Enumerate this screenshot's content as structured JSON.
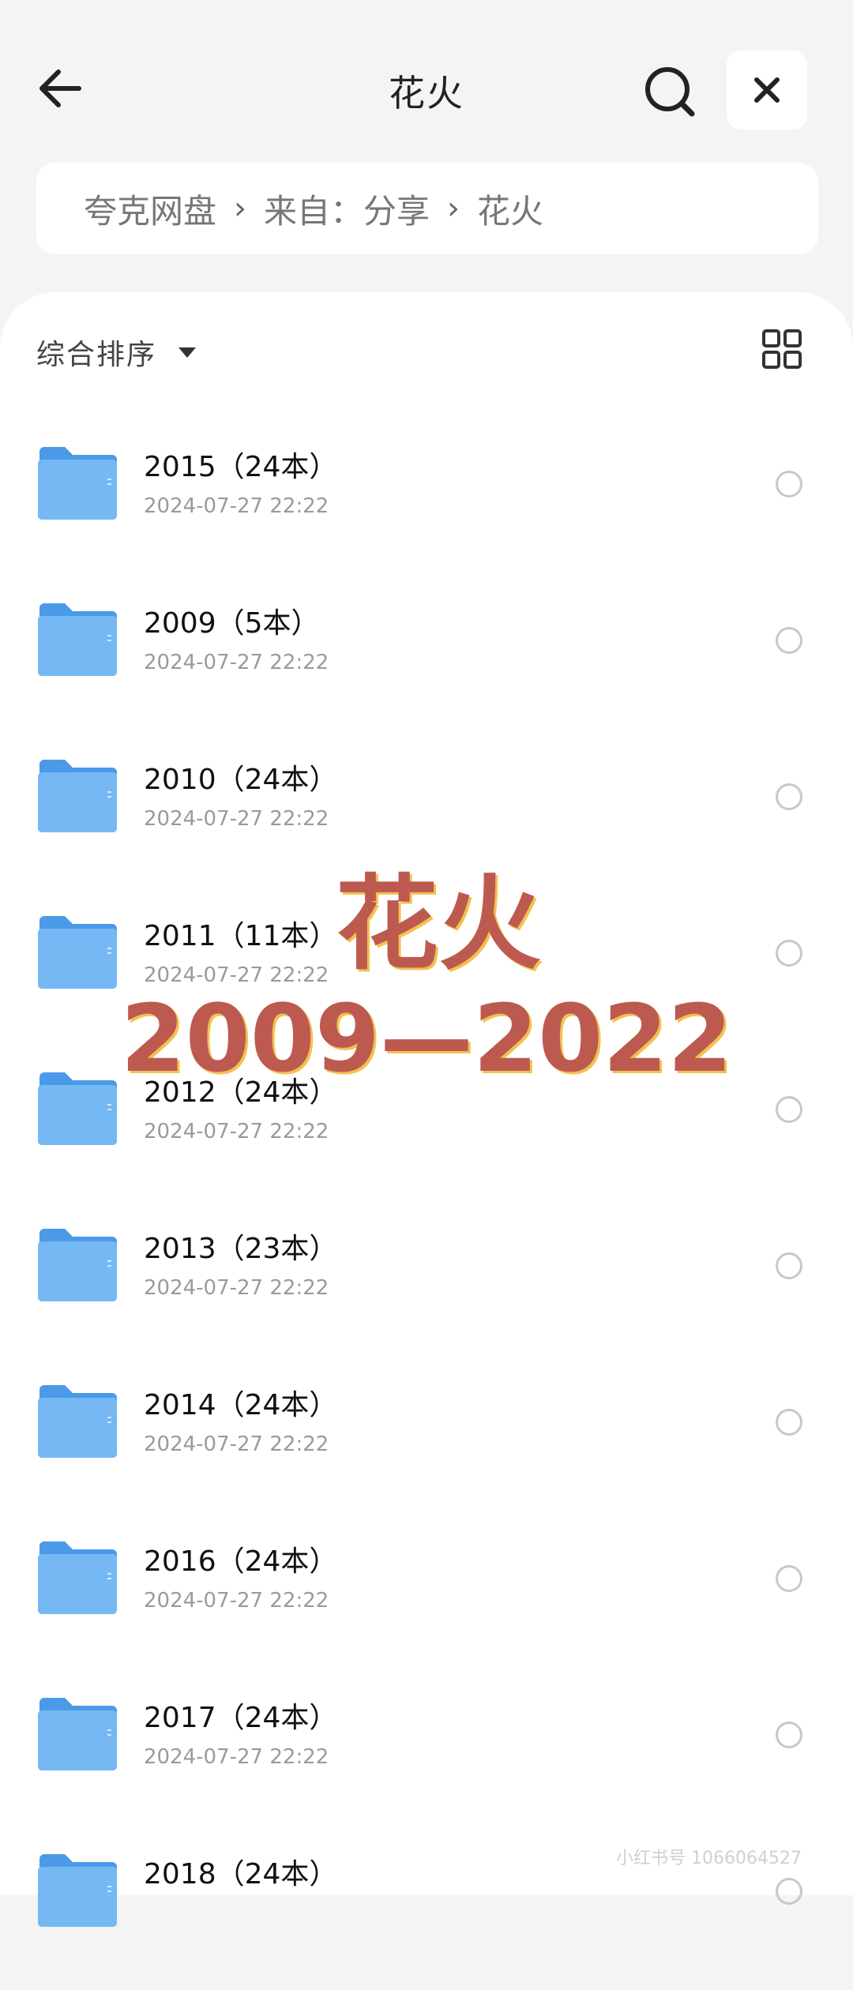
{
  "header": {
    "title": "花火",
    "back_icon": "arrow-left-icon",
    "search_icon": "search-icon",
    "close_icon": "close-icon"
  },
  "breadcrumb": {
    "items": [
      "夸克网盘",
      "来自：分享",
      "花火"
    ]
  },
  "toolbar": {
    "sort_label": "综合排序",
    "view_icon": "grid-view-icon"
  },
  "files": [
    {
      "name": "2015（24本）",
      "date": "2024-07-27 22:22"
    },
    {
      "name": "2009（5本）",
      "date": "2024-07-27 22:22"
    },
    {
      "name": "2010（24本）",
      "date": "2024-07-27 22:22"
    },
    {
      "name": "2011（11本）",
      "date": "2024-07-27 22:22"
    },
    {
      "name": "2012（24本）",
      "date": "2024-07-27 22:22"
    },
    {
      "name": "2013（23本）",
      "date": "2024-07-27 22:22"
    },
    {
      "name": "2014（24本）",
      "date": "2024-07-27 22:22"
    },
    {
      "name": "2016（24本）",
      "date": "2024-07-27 22:22"
    },
    {
      "name": "2017（24本）",
      "date": "2024-07-27 22:22"
    },
    {
      "name": "2018（24本）",
      "date": ""
    }
  ],
  "overlay": {
    "line1": "花火",
    "line2": "2009—2022"
  },
  "watermark": "小红书号 1066064527",
  "colors": {
    "folder": "#5aa8f0",
    "overlay_text": "#bd5a50",
    "overlay_shadow": "#f3c14f"
  }
}
